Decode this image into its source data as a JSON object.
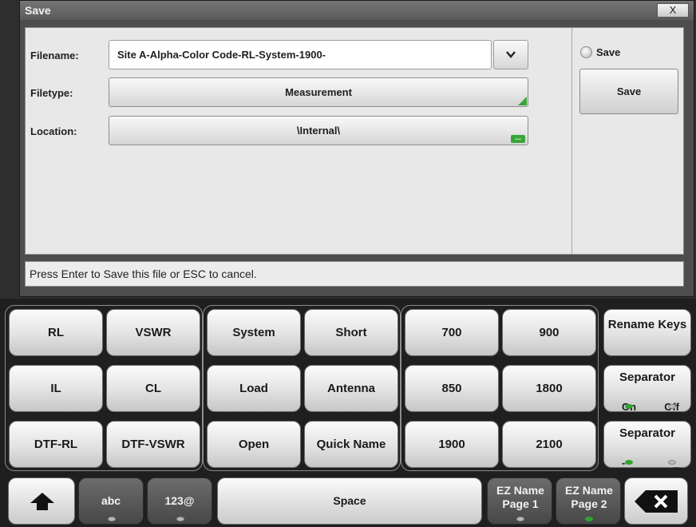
{
  "dialog": {
    "title": "Save",
    "close_symbol": "X",
    "filename_label": "Filename:",
    "filename_value": "Site A-Alpha-Color Code-RL-System-1900-",
    "filetype_label": "Filetype:",
    "filetype_value": "Measurement",
    "location_label": "Location:",
    "location_value": "\\Internal\\",
    "save_option_label": "Save",
    "save_button_label": "Save",
    "status_message": "Press Enter to Save this file or ESC to cancel."
  },
  "keyboard": {
    "group1": [
      "RL",
      "VSWR",
      "IL",
      "CL",
      "DTF-RL",
      "DTF-VSWR"
    ],
    "group2": [
      "System",
      "Short",
      "Load",
      "Antenna",
      "Open",
      "Quick Name"
    ],
    "group3": [
      "700",
      "900",
      "850",
      "1800",
      "1900",
      "2100"
    ],
    "rename_keys": "Rename Keys",
    "separator_onoff": {
      "label": "Separator",
      "on": "On",
      "off": "Off",
      "state": "On"
    },
    "separator_char": {
      "label": "Separator",
      "left": "-",
      "right": "_",
      "selected": "-"
    },
    "abc_label": "abc",
    "num_label": "123@",
    "space_label": "Space",
    "ez_page1": "EZ Name Page 1",
    "ez_page2": "EZ Name Page 2",
    "ez_active_page": "2",
    "abc_active": false,
    "num_active": false
  },
  "icons": {
    "shift": "up-arrow-icon",
    "backspace": "backspace-x-icon",
    "dropdown": "chevron-down-icon",
    "close": "close-icon"
  },
  "colors": {
    "indicator_on": "#2fa42f",
    "indicator_off": "#b9b9b9",
    "corner_marker": "#3aa53a"
  }
}
